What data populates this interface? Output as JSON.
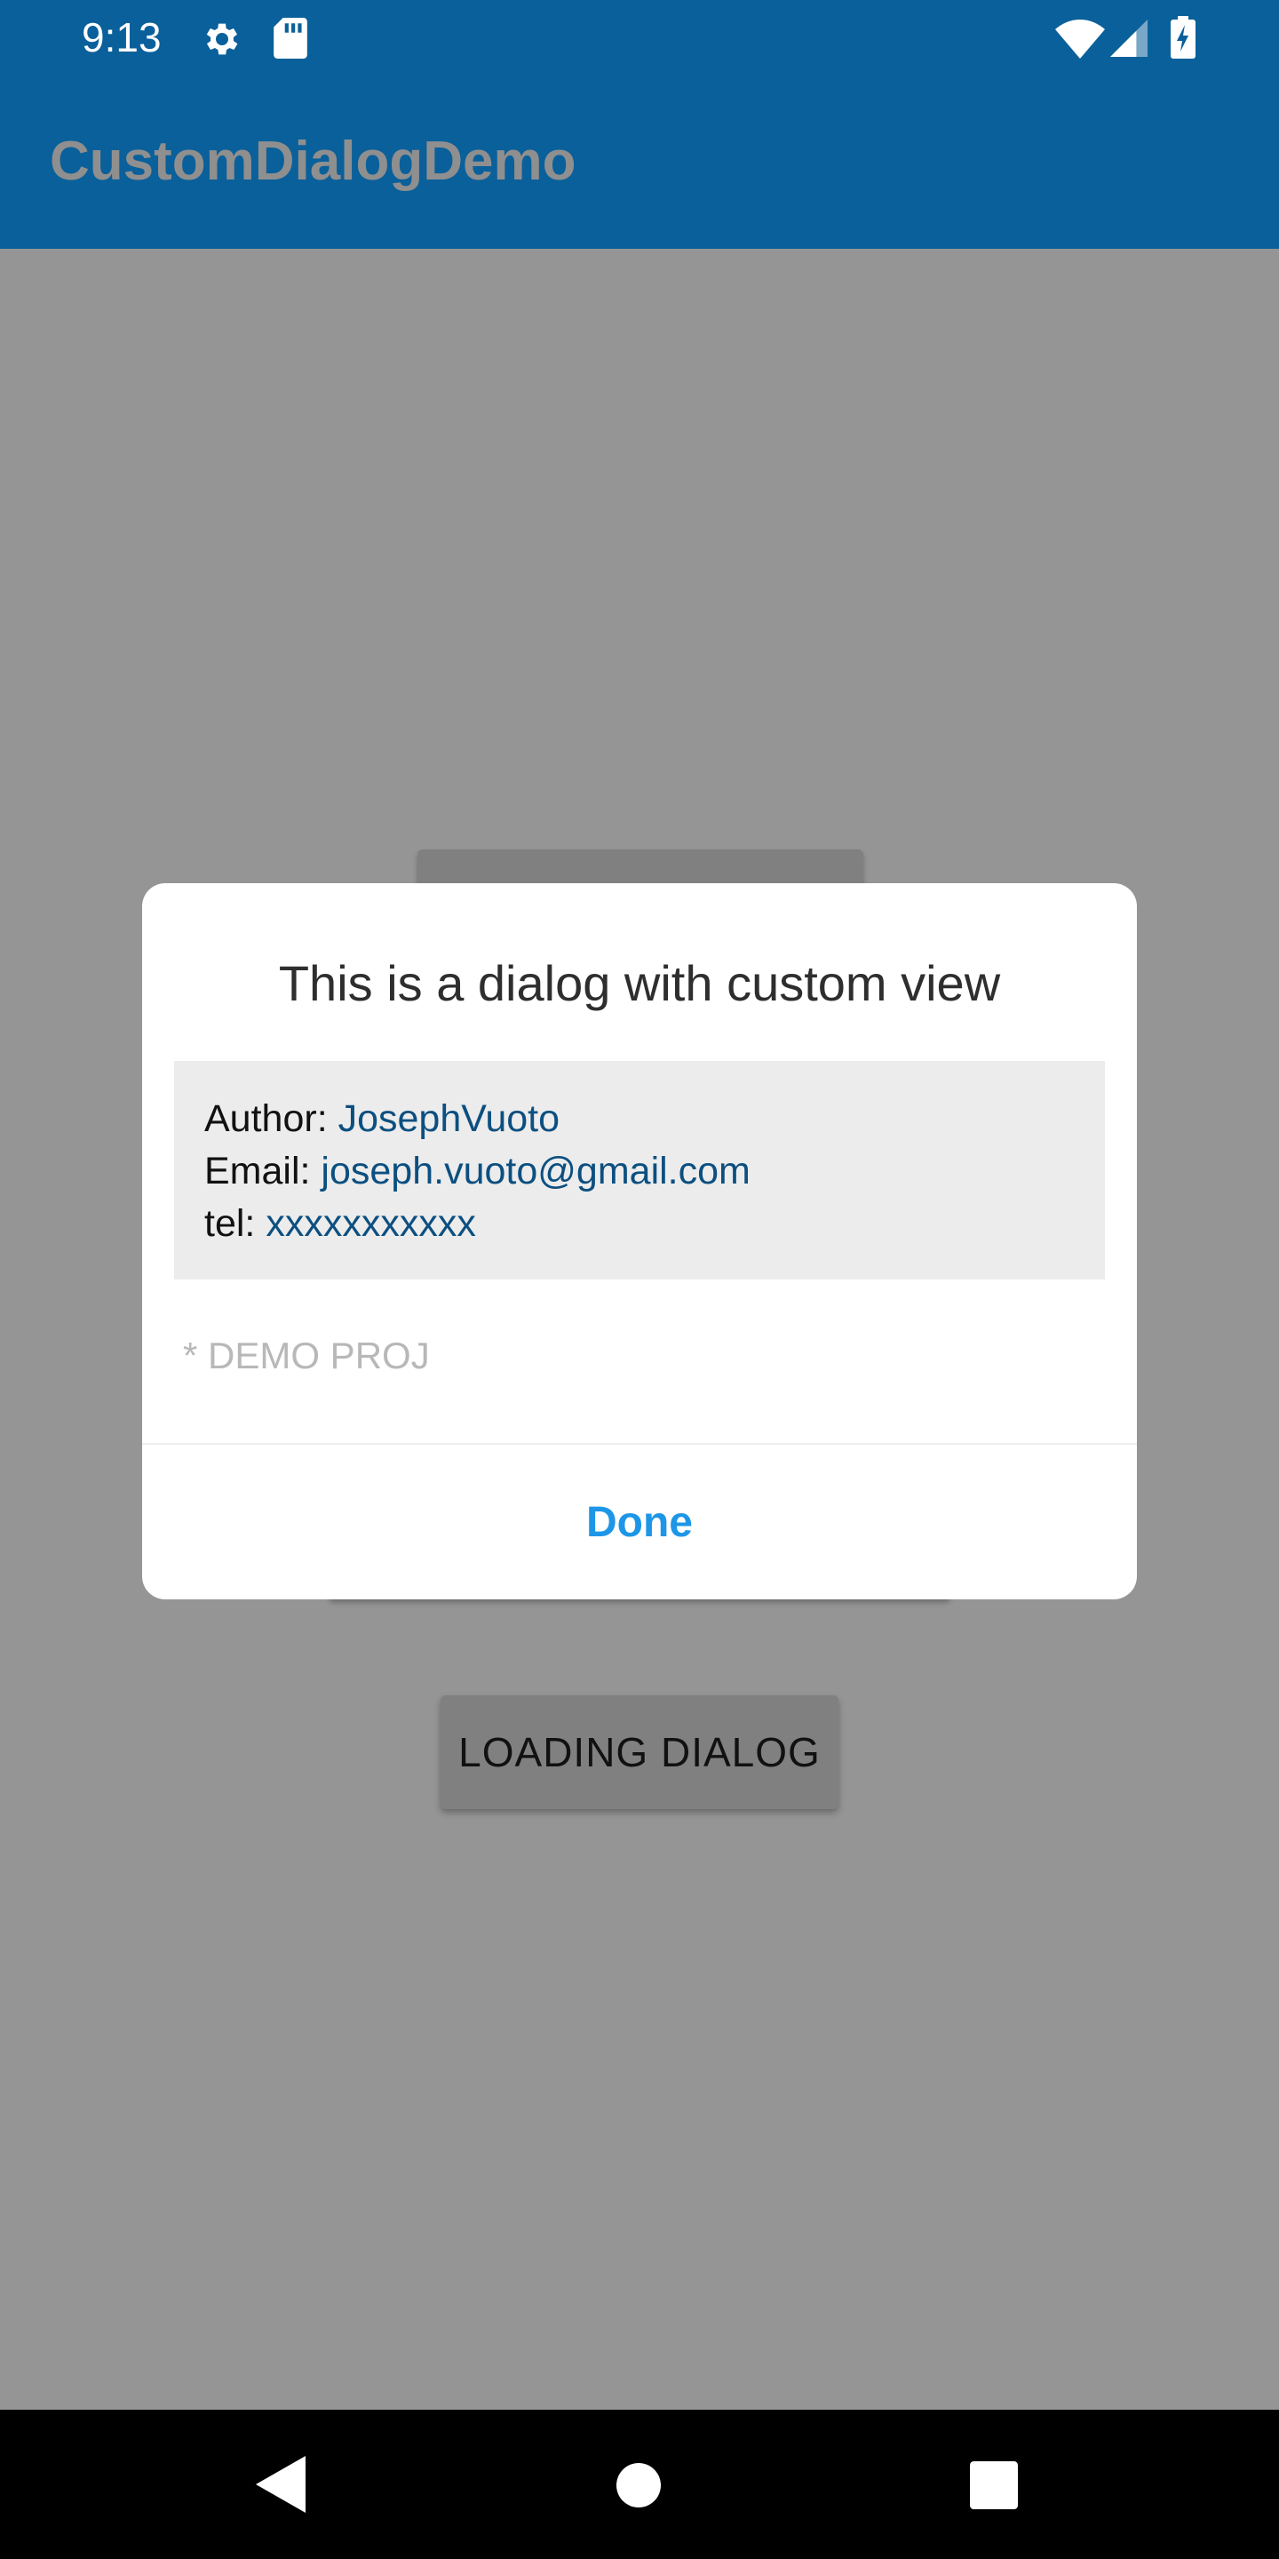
{
  "status_bar": {
    "time": "9:13",
    "icons": [
      "gear-icon",
      "sd-card-icon",
      "wifi-icon",
      "cell-signal-icon",
      "battery-charging-icon"
    ]
  },
  "app_bar": {
    "title": "CustomDialogDemo"
  },
  "background": {
    "loading_dialog_button": "LOADING DIALOG"
  },
  "dialog": {
    "title": "This is a dialog with custom view",
    "info": {
      "author_label": "Author: ",
      "author_value": "JosephVuoto",
      "email_label": "Email: ",
      "email_value": "joseph.vuoto@gmail.com",
      "tel_label": "tel: ",
      "tel_value": "xxxxxxxxxxx"
    },
    "note": "* DEMO PROJ",
    "done_label": "Done"
  },
  "colors": {
    "primary": "#0a609a",
    "scrim_background": "#959595",
    "accent": "#1e96e8",
    "link_text": "#0c4f80"
  }
}
